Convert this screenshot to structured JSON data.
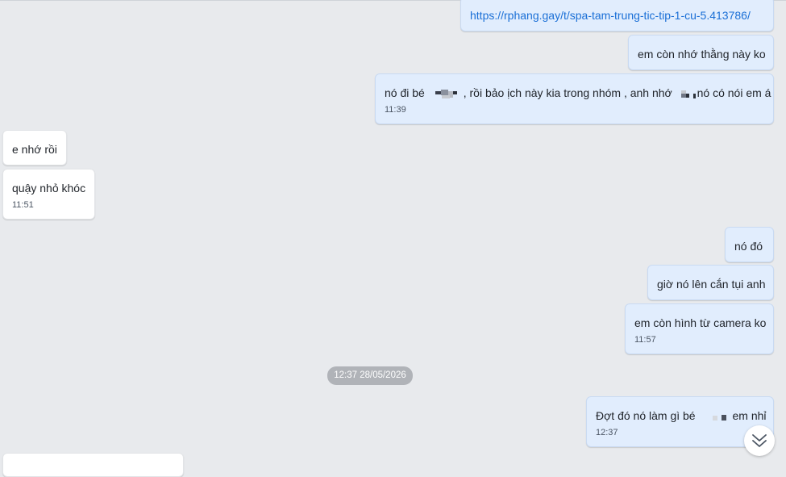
{
  "messages": [
    {
      "id": "m1",
      "direction": "out",
      "text": "https://rphang.gay/t/spa-tam-trung-tic-tip-1-cu-5.413786/",
      "is_link": true
    },
    {
      "id": "m2",
      "direction": "out",
      "text": "em còn nhớ thằng này ko"
    },
    {
      "id": "m3",
      "direction": "out",
      "text_parts": [
        "nó đi bé",
        ", rồi bảo ịch này kia trong nhóm , anh nhớ",
        "nó có nói em á"
      ],
      "time": "11:39"
    },
    {
      "id": "m4",
      "direction": "in",
      "text": "e nhớ rồi"
    },
    {
      "id": "m5",
      "direction": "in",
      "text": "quậy nhỏ khóc",
      "time": "11:51"
    },
    {
      "id": "m6",
      "direction": "out",
      "text": "nó đó"
    },
    {
      "id": "m7",
      "direction": "out",
      "text": "giờ nó lên cắn tụi anh"
    },
    {
      "id": "m8",
      "direction": "out",
      "text": "em còn hình từ camera ko",
      "time": "11:57"
    },
    {
      "id": "m9",
      "direction": "out",
      "text_parts": [
        "Đợt đó nó làm gì bé",
        "em nhỉ"
      ],
      "time": "12:37"
    }
  ],
  "date_separator": "12:37 28/05/2026",
  "icons": {
    "scroll_down": "double-chevron-down-icon",
    "redacted": "pixelated-redaction"
  },
  "colors": {
    "background": "#e8eaed",
    "outgoing_bubble": "#e1edfd",
    "incoming_bubble": "#ffffff",
    "link": "#1a6fd6",
    "date_badge": "#b0b3b8"
  }
}
